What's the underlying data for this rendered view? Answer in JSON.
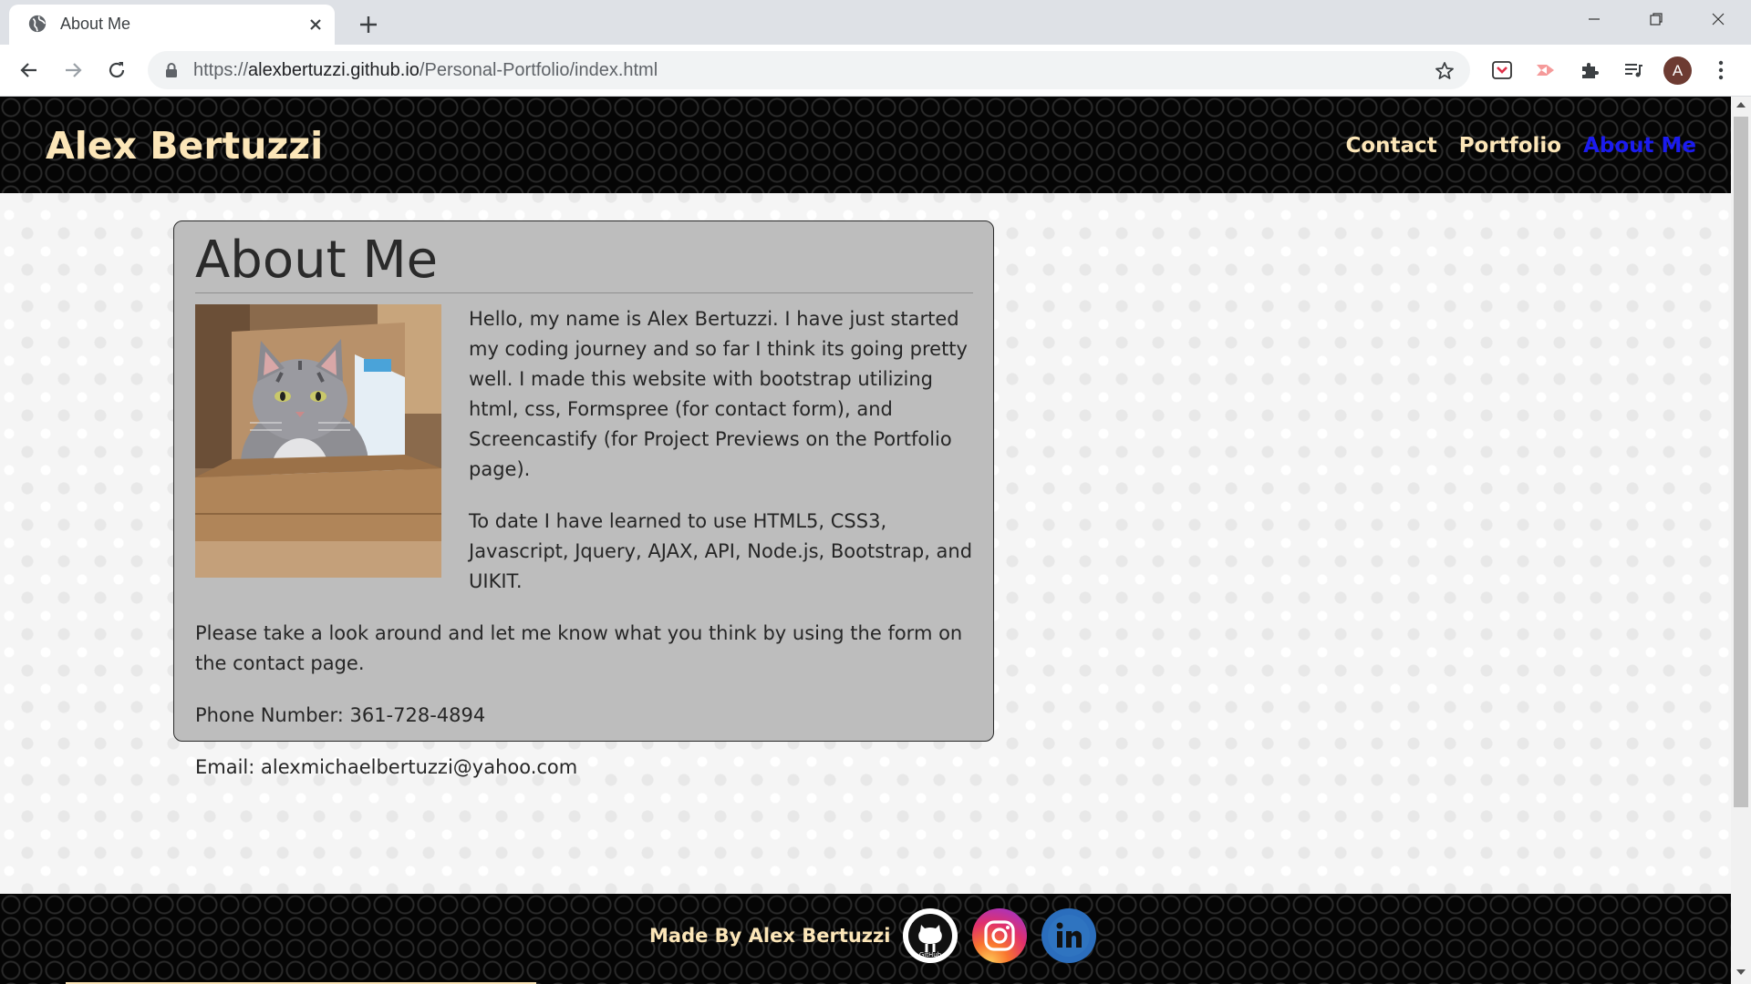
{
  "browser": {
    "tab_title": "About Me",
    "url_scheme": "https://",
    "url_host": "alexbertuzzi.github.io",
    "url_path": "/Personal-Portfolio/index.html",
    "avatar_letter": "A"
  },
  "site": {
    "brand": "Alex Bertuzzi",
    "nav": {
      "contact": "Contact",
      "portfolio": "Portfolio",
      "about": "About Me"
    }
  },
  "about": {
    "heading": "About Me",
    "paragraphs": [
      "Hello, my name is Alex Bertuzzi. I have just started my coding journey and so far I think its going pretty well. I made this website with bootstrap utilizing html, css, Formspree (for contact form), and Screencastify (for Project Previews on the Portfolio page).",
      "To date I have learned to use HTML5, CSS3, Javascript, Jquery, AJAX, API, Node.js, Bootstrap, and UIKIT.",
      "Please take a look around and let me know what you think by using the form on the contact page.",
      "Phone Number: 361-728-4894",
      "Email: alexmichaelbertuzzi@yahoo.com"
    ]
  },
  "footer": {
    "text": "Made By Alex Bertuzzi",
    "social_icons": [
      "github-icon",
      "instagram-icon",
      "linkedin-icon"
    ]
  },
  "colors": {
    "brand_text": "#fce6b8",
    "nav_active": "#1b1bf0",
    "card_bg": "#bdbdbd",
    "header_bg": "#050505"
  }
}
